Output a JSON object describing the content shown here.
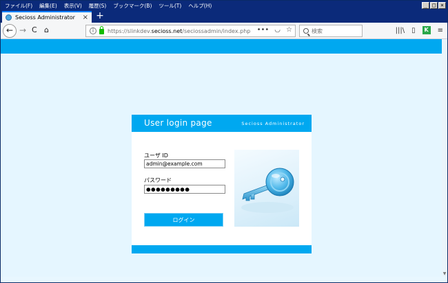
{
  "browser": {
    "menu": [
      "ファイル(F)",
      "編集(E)",
      "表示(V)",
      "履歴(S)",
      "ブックマーク(B)",
      "ツール(T)",
      "ヘルプ(H)"
    ],
    "window_controls": [
      "_",
      "□",
      "×"
    ],
    "tab": {
      "title": "Secioss Administrator",
      "close": "×"
    },
    "new_tab": "+",
    "nav": {
      "back": "←",
      "forward": "→",
      "reload": "C",
      "home": "⌂"
    },
    "url": {
      "prefix": "https://slinkdev.",
      "domain": "secioss.net",
      "path": "/seciossadmin/index.php",
      "actions_dots": "•••",
      "pocket": "◡",
      "star": "☆"
    },
    "search": {
      "placeholder": "検索"
    },
    "toolbar_icons": {
      "library": "|||\\",
      "sidebar": "▯",
      "extension": "K",
      "menu": "≡"
    }
  },
  "login": {
    "title": "User login page",
    "brand": "Secioss Administrator",
    "user_label": "ユーザ ID",
    "user_value": "admin@example.com",
    "password_label": "パスワード",
    "password_value": "●●●●●●●●●",
    "submit": "ログイン"
  },
  "colors": {
    "accent": "#00a8f0",
    "page_bg": "#e5f6ff",
    "title_bar": "#0b2a7a"
  }
}
